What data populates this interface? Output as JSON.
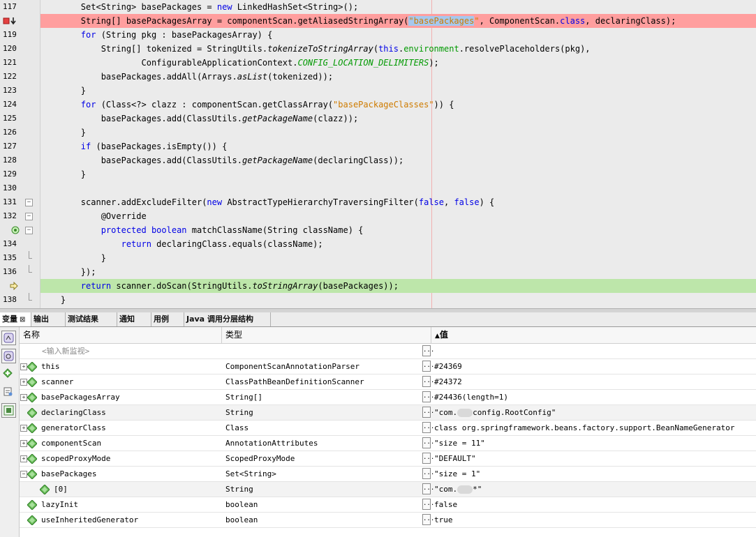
{
  "editor": {
    "lines": [
      {
        "num": "117",
        "marker": "",
        "fold": "",
        "bg": "",
        "tokens": [
          [
            "",
            "\t\tSet<String> basePackages = "
          ],
          [
            "kw",
            "new"
          ],
          [
            "",
            " LinkedHashSet<String>();"
          ]
        ]
      },
      {
        "num": "",
        "marker": "breakpoint",
        "fold": "",
        "bg": "bp",
        "tokens": [
          [
            "",
            "\t\tString[] basePackagesArray = componentScan.getAliasedStringArray("
          ],
          [
            "str sel",
            "\"basePackages"
          ],
          [
            "str",
            "\""
          ],
          [
            "",
            ", ComponentScan."
          ],
          [
            "kw",
            "class"
          ],
          [
            "",
            ", declaringClass);"
          ]
        ]
      },
      {
        "num": "119",
        "marker": "",
        "fold": "",
        "bg": "",
        "tokens": [
          [
            "kw",
            "\t\tfor"
          ],
          [
            "",
            " (String pkg : basePackagesArray) {"
          ]
        ]
      },
      {
        "num": "120",
        "marker": "",
        "fold": "",
        "bg": "",
        "tokens": [
          [
            "",
            "\t\t\tString[] tokenized = StringUtils."
          ],
          [
            "itl",
            "tokenizeToStringArray"
          ],
          [
            "",
            "("
          ],
          [
            "kw",
            "this"
          ],
          [
            "",
            "."
          ],
          [
            "fld",
            "environment"
          ],
          [
            "",
            ".resolvePlaceholders(pkg),"
          ]
        ]
      },
      {
        "num": "121",
        "marker": "",
        "fold": "",
        "bg": "",
        "tokens": [
          [
            "",
            "\t\t\t\t\tConfigurableApplicationContext."
          ],
          [
            "fld itl",
            "CONFIG_LOCATION_DELIMITERS"
          ],
          [
            "",
            ");"
          ]
        ]
      },
      {
        "num": "122",
        "marker": "",
        "fold": "",
        "bg": "",
        "tokens": [
          [
            "",
            "\t\t\tbasePackages.addAll(Arrays."
          ],
          [
            "itl",
            "asList"
          ],
          [
            "",
            "(tokenized));"
          ]
        ]
      },
      {
        "num": "123",
        "marker": "",
        "fold": "",
        "bg": "",
        "tokens": [
          [
            "",
            "\t\t}"
          ]
        ]
      },
      {
        "num": "124",
        "marker": "",
        "fold": "",
        "bg": "",
        "tokens": [
          [
            "kw",
            "\t\tfor"
          ],
          [
            "",
            " (Class<?> clazz : componentScan.getClassArray("
          ],
          [
            "str",
            "\"basePackageClasses\""
          ],
          [
            "",
            ")) {"
          ]
        ]
      },
      {
        "num": "125",
        "marker": "",
        "fold": "",
        "bg": "",
        "tokens": [
          [
            "",
            "\t\t\tbasePackages.add(ClassUtils."
          ],
          [
            "itl",
            "getPackageName"
          ],
          [
            "",
            "(clazz));"
          ]
        ]
      },
      {
        "num": "126",
        "marker": "",
        "fold": "",
        "bg": "",
        "tokens": [
          [
            "",
            "\t\t}"
          ]
        ]
      },
      {
        "num": "127",
        "marker": "",
        "fold": "",
        "bg": "",
        "tokens": [
          [
            "kw",
            "\t\tif"
          ],
          [
            "",
            " (basePackages.isEmpty()) {"
          ]
        ]
      },
      {
        "num": "128",
        "marker": "",
        "fold": "",
        "bg": "",
        "tokens": [
          [
            "",
            "\t\t\tbasePackages.add(ClassUtils."
          ],
          [
            "itl",
            "getPackageName"
          ],
          [
            "",
            "(declaringClass));"
          ]
        ]
      },
      {
        "num": "129",
        "marker": "",
        "fold": "",
        "bg": "",
        "tokens": [
          [
            "",
            "\t\t}"
          ]
        ]
      },
      {
        "num": "130",
        "marker": "",
        "fold": "",
        "bg": "",
        "tokens": [
          [
            "",
            ""
          ]
        ]
      },
      {
        "num": "131",
        "marker": "",
        "fold": "open",
        "bg": "",
        "tokens": [
          [
            "",
            "\t\tscanner.addExcludeFilter("
          ],
          [
            "kw",
            "new"
          ],
          [
            "",
            " AbstractTypeHierarchyTraversingFilter("
          ],
          [
            "kw",
            "false"
          ],
          [
            "",
            ", "
          ],
          [
            "kw",
            "false"
          ],
          [
            "",
            ") {"
          ]
        ]
      },
      {
        "num": "132",
        "marker": "",
        "fold": "open",
        "bg": "",
        "tokens": [
          [
            "",
            "\t\t\t@Override"
          ]
        ]
      },
      {
        "num": "",
        "marker": "override",
        "fold": "open",
        "bg": "",
        "tokens": [
          [
            "kw",
            "\t\t\tprotected boolean"
          ],
          [
            "",
            " matchClassName(String className) {"
          ]
        ]
      },
      {
        "num": "134",
        "marker": "",
        "fold": "",
        "bg": "",
        "tokens": [
          [
            "kw",
            "\t\t\t\treturn"
          ],
          [
            "",
            " declaringClass.equals(className);"
          ]
        ]
      },
      {
        "num": "135",
        "marker": "",
        "fold": "close",
        "bg": "",
        "tokens": [
          [
            "",
            "\t\t\t}"
          ]
        ]
      },
      {
        "num": "136",
        "marker": "",
        "fold": "close",
        "bg": "",
        "tokens": [
          [
            "",
            "\t\t});"
          ]
        ]
      },
      {
        "num": "",
        "marker": "current",
        "fold": "",
        "bg": "cur",
        "tokens": [
          [
            "kw",
            "\t\treturn"
          ],
          [
            "",
            " scanner.doScan(StringUtils."
          ],
          [
            "itl",
            "toStringArray"
          ],
          [
            "",
            "(basePackages));"
          ]
        ]
      },
      {
        "num": "138",
        "marker": "",
        "fold": "close",
        "bg": "",
        "tokens": [
          [
            "",
            "\t}"
          ]
        ]
      }
    ]
  },
  "tabs": [
    {
      "label": "变量",
      "close": "⊠",
      "active": true
    },
    {
      "label": "输出",
      "active": false
    },
    {
      "label": "测试结果",
      "active": false
    },
    {
      "label": "通知",
      "active": false
    },
    {
      "label": "用例",
      "active": false
    },
    {
      "label": "Java 调用分层结构",
      "active": false
    }
  ],
  "variables": {
    "headers": {
      "name": "名称",
      "type": "类型",
      "value": "值",
      "sort_arrow": "▲"
    },
    "new_watch_placeholder": "<输入新监视>",
    "ellipsis": "...",
    "rows": [
      {
        "name": "this",
        "type": "ComponentScanAnnotationParser",
        "value": "#24369",
        "expander": "+",
        "level": 0,
        "value_blur": false
      },
      {
        "name": "scanner",
        "type": "ClassPathBeanDefinitionScanner",
        "value": "#24372",
        "expander": "+",
        "level": 0
      },
      {
        "name": "basePackagesArray",
        "type": "String[]",
        "value": "#24436(length=1)",
        "expander": "+",
        "level": 0
      },
      {
        "name": "declaringClass",
        "type": "String",
        "value_pre": "\"com.",
        "value_post": "config.RootConfig\"",
        "expander": "",
        "level": 0
      },
      {
        "name": "generatorClass",
        "type": "Class",
        "value": "class org.springframework.beans.factory.support.BeanNameGenerator",
        "expander": "+",
        "level": 0
      },
      {
        "name": "componentScan",
        "type": "AnnotationAttributes",
        "value": "\"size = 11\"",
        "expander": "+",
        "level": 0
      },
      {
        "name": "scopedProxyMode",
        "type": "ScopedProxyMode",
        "value": "\"DEFAULT\"",
        "expander": "+",
        "level": 0
      },
      {
        "name": "basePackages",
        "type": "Set<String>",
        "value": "\"size = 1\"",
        "expander": "-",
        "level": 0
      },
      {
        "name": "[0]",
        "type": "String",
        "value_pre": "\"com.",
        "value_post": "*\"",
        "expander": "",
        "level": 1
      },
      {
        "name": "lazyInit",
        "type": "boolean",
        "value": "false",
        "expander": "",
        "level": 0
      },
      {
        "name": "useInheritedGenerator",
        "type": "boolean",
        "value": "true",
        "expander": "",
        "level": 0
      }
    ]
  },
  "colors": {
    "breakpoint": "#ff9e9e",
    "current_line": "#bde6aa",
    "keyword": "#0000e6",
    "string": "#ce7b00",
    "field": "#009900"
  }
}
